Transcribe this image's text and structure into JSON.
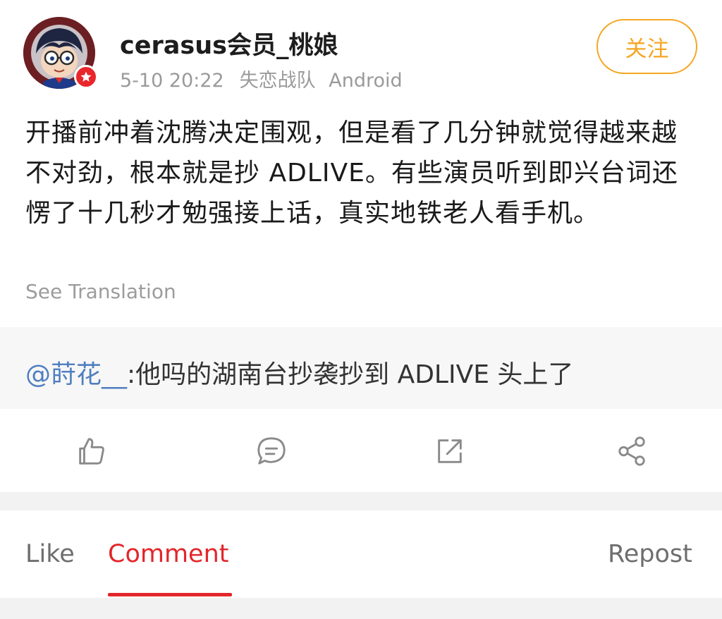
{
  "author": {
    "name": "cerasus会员_桃娘",
    "time": "5-10 20:22",
    "source": "失恋战队",
    "client": "Android",
    "follow_label": "关注"
  },
  "post": {
    "text": "开播前冲着沈腾决定围观，但是看了几分钟就觉得越来越不对劲，根本就是抄 ADLIVE。有些演员听到即兴台词还愣了十几秒才勉强接上话，真实地铁老人看手机。",
    "see_translation": "See Translation"
  },
  "quote": {
    "mention": "@莳花__",
    "text": ":他吗的湖南台抄袭抄到 ADLIVE 头上了"
  },
  "actions": [
    "like-icon",
    "comment-icon",
    "repost-icon",
    "share-icon"
  ],
  "tabs": {
    "like": "Like",
    "comment": "Comment",
    "repost": "Repost",
    "active": "comment"
  },
  "colors": {
    "accent": "#e2262b",
    "follow": "#f5a623",
    "mention": "#4f7fbf",
    "muted": "#9a9a9a"
  }
}
